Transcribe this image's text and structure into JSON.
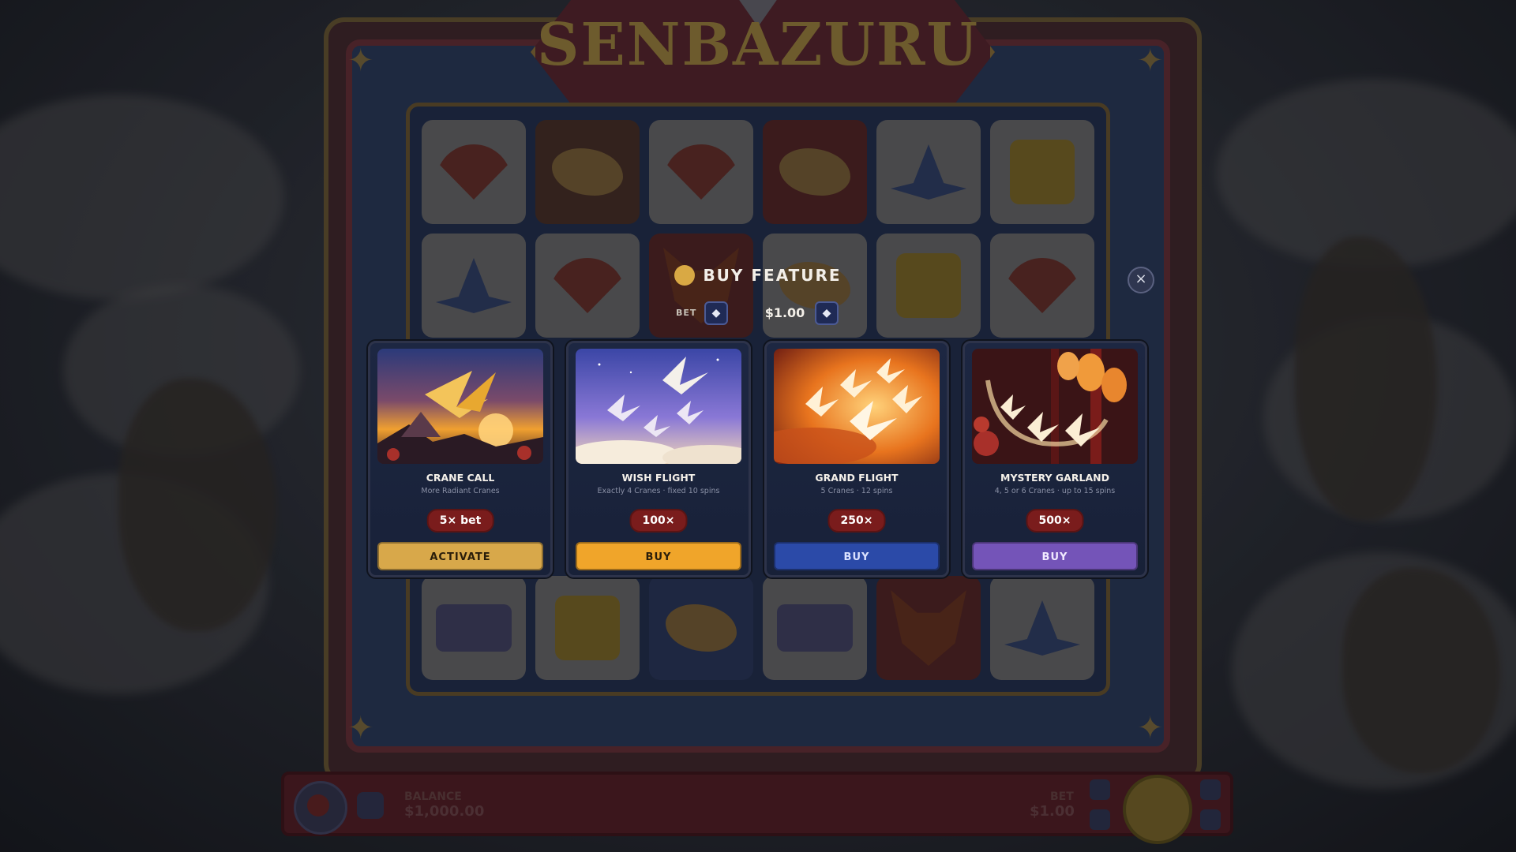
{
  "game": {
    "title": "SENBAZURU"
  },
  "modal": {
    "title": "BUY FEATURE",
    "close_icon": "×",
    "bet": {
      "label": "BET",
      "value": "$1.00",
      "decrease_icon": "◆",
      "increase_icon": "◆"
    },
    "features": [
      {
        "name": "CRANE CALL",
        "subtitle": "More Radiant Cranes",
        "price": "5× bet",
        "button": "ACTIVATE",
        "button_color": "#d8a84a",
        "button_text_color": "#2a1d0a"
      },
      {
        "name": "WISH FLIGHT",
        "subtitle": "Exactly 4 Cranes · fixed 10 spins",
        "price": "100×",
        "button": "BUY",
        "button_color": "#f0a52a",
        "button_text_color": "#2a1d0a"
      },
      {
        "name": "GRAND FLIGHT",
        "subtitle": "5 Cranes · 12 spins",
        "price": "250×",
        "button": "BUY",
        "button_color": "#2b4aa8",
        "button_text_color": "#dbe2ff"
      },
      {
        "name": "MYSTERY GARLAND",
        "subtitle": "4, 5 or 6 Cranes · up to 15 spins",
        "price": "500×",
        "button": "BUY",
        "button_color": "#7454b8",
        "button_text_color": "#f1eaff"
      }
    ]
  },
  "hud": {
    "balance_label": "BALANCE",
    "balance_value": "$1,000.00",
    "bet_label": "BET",
    "bet_value": "$1.00"
  },
  "colors": {
    "coin": "#d9a944",
    "price_badge": "#7a1c1c",
    "card_bg": "#1d2742"
  }
}
